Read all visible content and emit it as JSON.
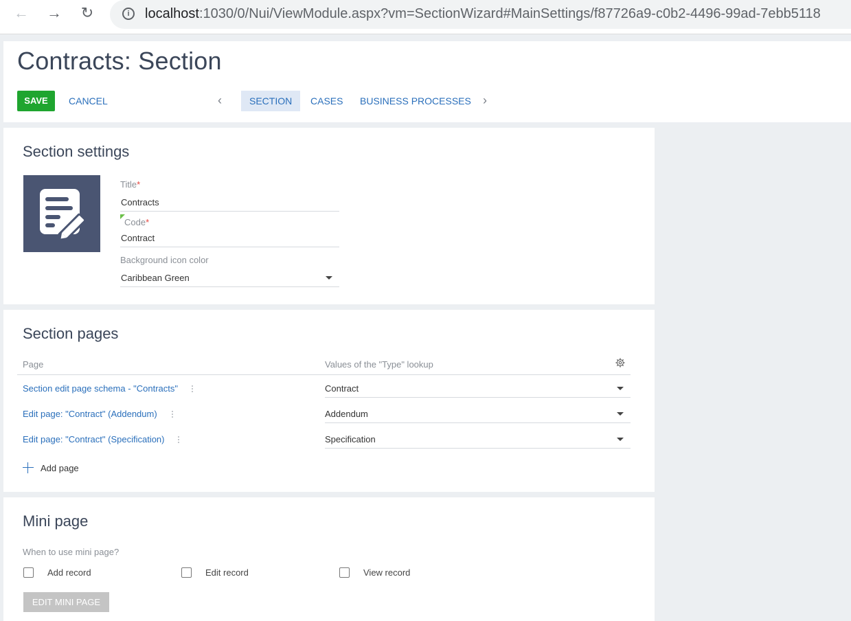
{
  "browser": {
    "back_icon": "arrow-left-icon",
    "forward_icon": "arrow-right-icon",
    "reload_icon": "reload-icon",
    "url_host": "localhost",
    "url_rest": ":1030/0/Nui/ViewModule.aspx?vm=SectionWizard#MainSettings/f87726a9-c0b2-4496-99ad-7ebb5118"
  },
  "header": {
    "title": "Contracts: Section",
    "save_label": "SAVE",
    "cancel_label": "CANCEL",
    "tabs": [
      {
        "label": "SECTION",
        "active": true
      },
      {
        "label": "CASES",
        "active": false
      },
      {
        "label": "BUSINESS PROCESSES",
        "active": false
      }
    ]
  },
  "settings": {
    "title": "Section settings",
    "title_label": "Title",
    "title_value": "Contracts",
    "code_label": "Code",
    "code_value": "Contract",
    "required_mark": "*",
    "bg_color_label": "Background icon color",
    "bg_color_value": "Caribbean Green",
    "icon": "edit-document-icon",
    "icon_bg": "#4a5572"
  },
  "pages": {
    "title": "Section pages",
    "col_page": "Page",
    "col_type": "Values of the \"Type\" lookup",
    "rows": [
      {
        "page": "Section edit page schema - \"Contracts\"",
        "type": "Contract"
      },
      {
        "page": "Edit page: \"Contract\" (Addendum)",
        "type": "Addendum"
      },
      {
        "page": "Edit page: \"Contract\" (Specification)",
        "type": "Specification"
      }
    ],
    "add_label": "Add page"
  },
  "mini": {
    "title": "Mini page",
    "question": "When to use mini page?",
    "options": [
      "Add record",
      "Edit record",
      "View record"
    ],
    "edit_button": "EDIT MINI PAGE"
  },
  "colors": {
    "accent": "#2a6fbb",
    "save": "#1fa52f",
    "active_tab_bg": "#dfe8f5"
  }
}
